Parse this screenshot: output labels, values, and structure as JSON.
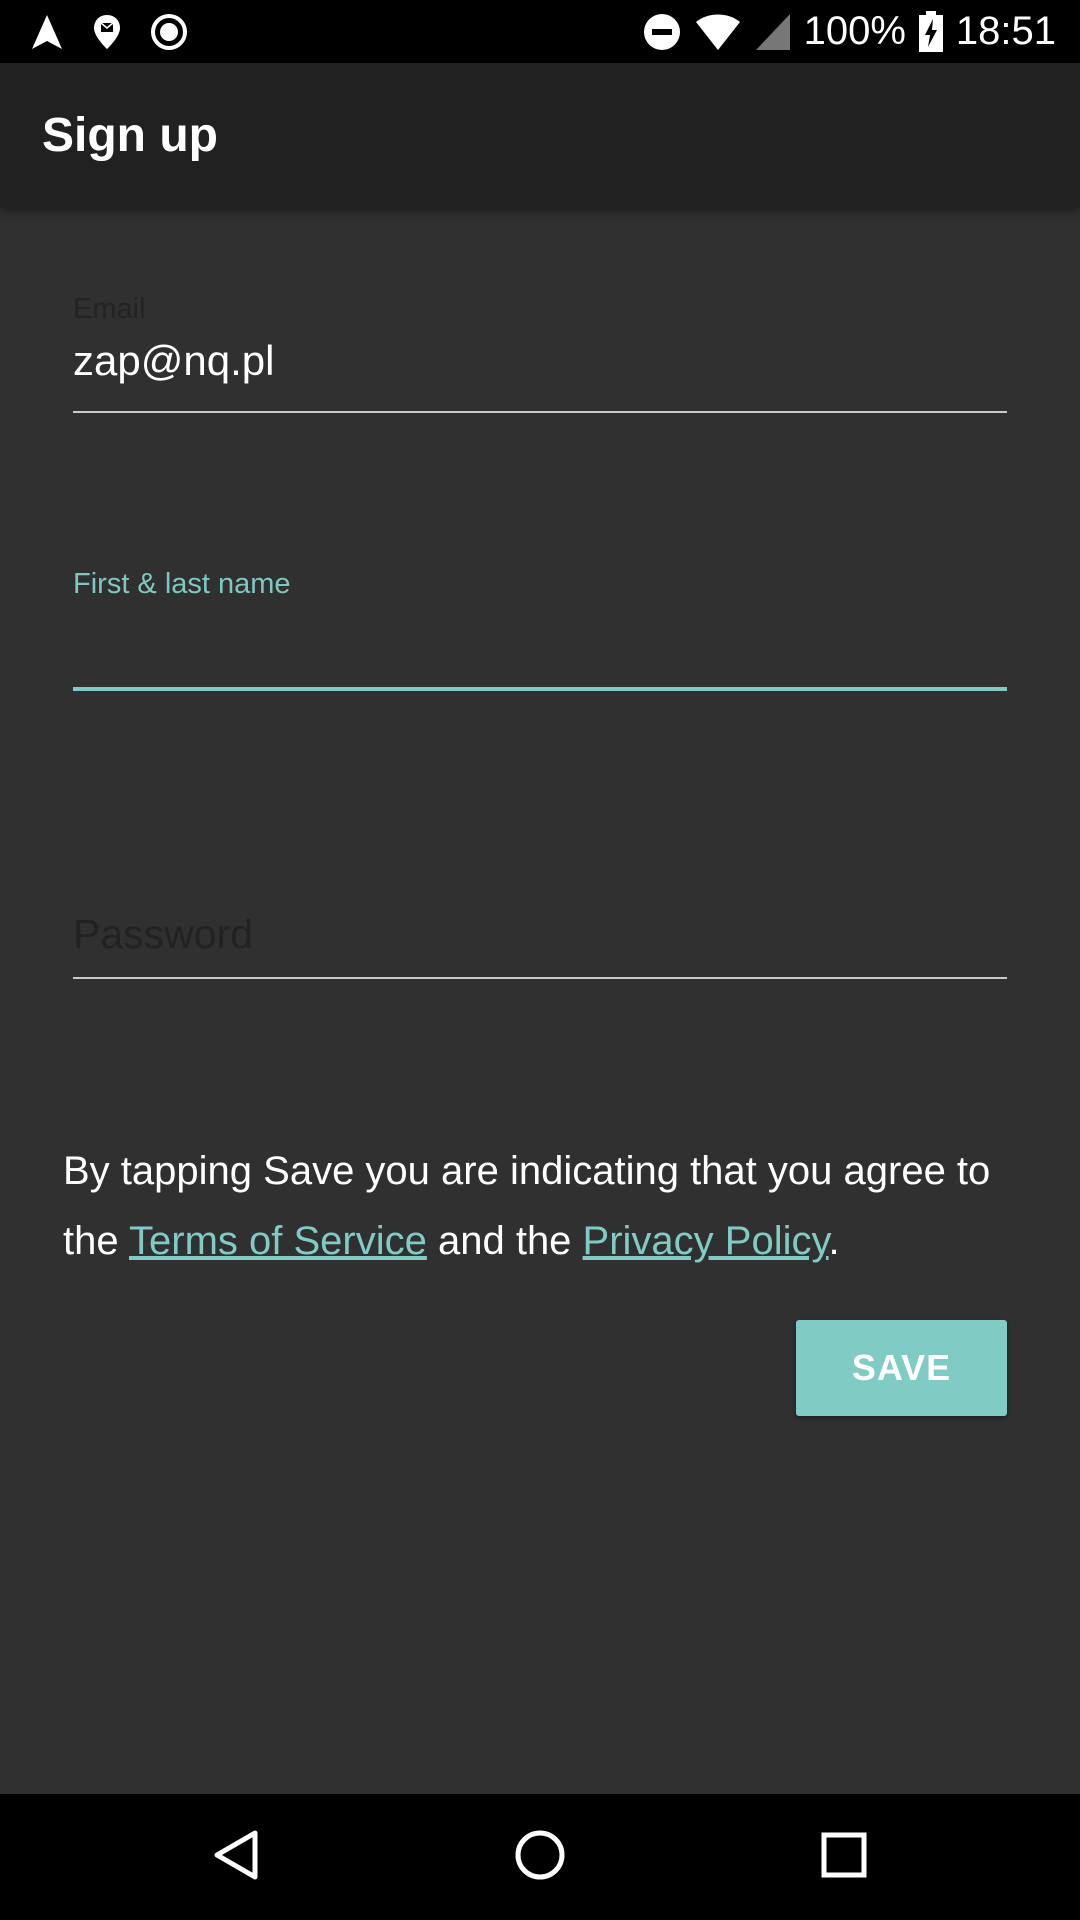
{
  "status_bar": {
    "battery_percent": "100%",
    "time": "18:51",
    "left_icons": [
      "navigation-arrow-icon",
      "location-pin-icon",
      "record-circle-icon"
    ],
    "right_icons": [
      "do-not-disturb-icon",
      "wifi-icon",
      "cell-signal-icon",
      "battery-charging-icon"
    ]
  },
  "app_bar": {
    "title": "Sign up"
  },
  "form": {
    "email": {
      "label": "Email",
      "value": "zap@nq.pl"
    },
    "name": {
      "label": "First & last name",
      "value": ""
    },
    "password": {
      "placeholder": "Password",
      "value": ""
    }
  },
  "terms": {
    "prefix": "By tapping Save you are indicating that you agree to the ",
    "terms_link": "Terms of Service",
    "middle": " and the ",
    "privacy_link": "Privacy Policy",
    "suffix": "."
  },
  "actions": {
    "save_label": "SAVE"
  },
  "nav_bar": {
    "buttons": [
      "back-icon",
      "home-icon",
      "recents-icon"
    ]
  },
  "colors": {
    "accent": "#80cbc4",
    "background": "#303030",
    "app_bar": "#212121"
  }
}
